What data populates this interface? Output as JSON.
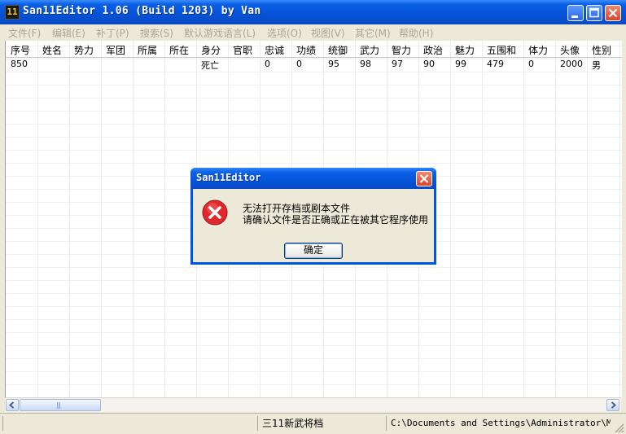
{
  "window": {
    "title": "San11Editor 1.06 (Build 1203) by Van",
    "icon_label": "11"
  },
  "menu": [
    "文件(F)",
    "编辑(E)",
    "补丁(P)",
    "搜索(S)",
    "默认游戏语言(L)",
    "选项(O)",
    "视图(V)",
    "其它(M)",
    "帮助(H)"
  ],
  "table": {
    "columns": [
      "序号",
      "姓名",
      "势力",
      "军团",
      "所属",
      "所在",
      "身分",
      "官职",
      "忠诚",
      "功绩",
      "统御",
      "武力",
      "智力",
      "政治",
      "魅力",
      "五围和",
      "体力",
      "头像",
      "性别"
    ],
    "rows": [
      [
        "850",
        "",
        "",
        "",
        "",
        "",
        "死亡",
        "",
        "0",
        "0",
        "95",
        "98",
        "97",
        "90",
        "99",
        "479",
        "0",
        "2000",
        "男"
      ]
    ]
  },
  "hscroll": {
    "grip": "|||"
  },
  "status": {
    "file_type": "三11新武将档",
    "path": "C:\\Documents and Settings\\Administrator\\My D"
  },
  "dialog": {
    "title": "San11Editor",
    "message_line1": "无法打开存档或剧本文件",
    "message_line2": "请确认文件是否正确或正在被其它程序使用",
    "ok_label": "确定",
    "icon": "error-icon"
  },
  "colors": {
    "title_blue": "#0552d8",
    "close_red": "#d8452a",
    "error_red": "#e0282d"
  }
}
